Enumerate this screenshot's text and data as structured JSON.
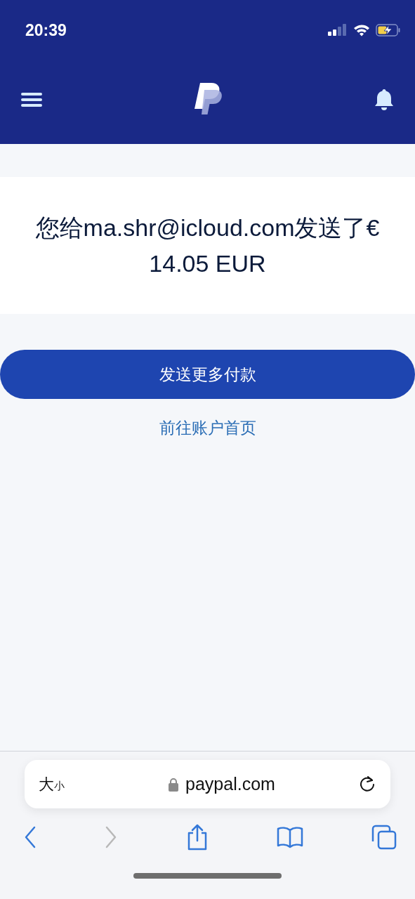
{
  "status_bar": {
    "time": "20:39"
  },
  "message": "您给ma.shr@icloud.com发送了€ 14.05 EUR",
  "primary_button": "发送更多付款",
  "link": "前往账户首页",
  "address_bar": {
    "text_size_large": "大",
    "text_size_small": "小",
    "url": "paypal.com"
  },
  "toolbar": [
    {
      "kind": "back",
      "disabled": false
    },
    {
      "kind": "forward",
      "disabled": true
    },
    {
      "kind": "share",
      "disabled": false
    },
    {
      "kind": "bookmarks",
      "disabled": false
    },
    {
      "kind": "tabs",
      "disabled": false
    }
  ]
}
